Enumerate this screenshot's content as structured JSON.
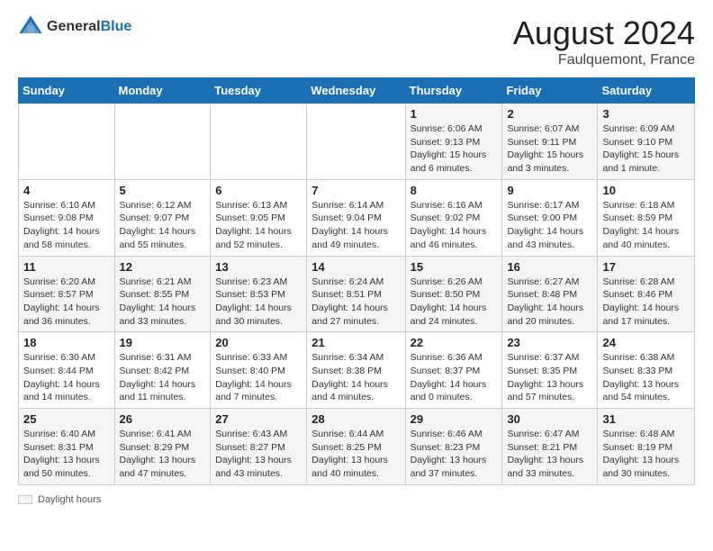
{
  "header": {
    "logo_general": "General",
    "logo_blue": "Blue",
    "month_year": "August 2024",
    "location": "Faulquemont, France"
  },
  "days_of_week": [
    "Sunday",
    "Monday",
    "Tuesday",
    "Wednesday",
    "Thursday",
    "Friday",
    "Saturday"
  ],
  "weeks": [
    [
      {
        "day": "",
        "info": ""
      },
      {
        "day": "",
        "info": ""
      },
      {
        "day": "",
        "info": ""
      },
      {
        "day": "",
        "info": ""
      },
      {
        "day": "1",
        "info": "Sunrise: 6:06 AM\nSunset: 9:13 PM\nDaylight: 15 hours and 6 minutes."
      },
      {
        "day": "2",
        "info": "Sunrise: 6:07 AM\nSunset: 9:11 PM\nDaylight: 15 hours and 3 minutes."
      },
      {
        "day": "3",
        "info": "Sunrise: 6:09 AM\nSunset: 9:10 PM\nDaylight: 15 hours and 1 minute."
      }
    ],
    [
      {
        "day": "4",
        "info": "Sunrise: 6:10 AM\nSunset: 9:08 PM\nDaylight: 14 hours and 58 minutes."
      },
      {
        "day": "5",
        "info": "Sunrise: 6:12 AM\nSunset: 9:07 PM\nDaylight: 14 hours and 55 minutes."
      },
      {
        "day": "6",
        "info": "Sunrise: 6:13 AM\nSunset: 9:05 PM\nDaylight: 14 hours and 52 minutes."
      },
      {
        "day": "7",
        "info": "Sunrise: 6:14 AM\nSunset: 9:04 PM\nDaylight: 14 hours and 49 minutes."
      },
      {
        "day": "8",
        "info": "Sunrise: 6:16 AM\nSunset: 9:02 PM\nDaylight: 14 hours and 46 minutes."
      },
      {
        "day": "9",
        "info": "Sunrise: 6:17 AM\nSunset: 9:00 PM\nDaylight: 14 hours and 43 minutes."
      },
      {
        "day": "10",
        "info": "Sunrise: 6:18 AM\nSunset: 8:59 PM\nDaylight: 14 hours and 40 minutes."
      }
    ],
    [
      {
        "day": "11",
        "info": "Sunrise: 6:20 AM\nSunset: 8:57 PM\nDaylight: 14 hours and 36 minutes."
      },
      {
        "day": "12",
        "info": "Sunrise: 6:21 AM\nSunset: 8:55 PM\nDaylight: 14 hours and 33 minutes."
      },
      {
        "day": "13",
        "info": "Sunrise: 6:23 AM\nSunset: 8:53 PM\nDaylight: 14 hours and 30 minutes."
      },
      {
        "day": "14",
        "info": "Sunrise: 6:24 AM\nSunset: 8:51 PM\nDaylight: 14 hours and 27 minutes."
      },
      {
        "day": "15",
        "info": "Sunrise: 6:26 AM\nSunset: 8:50 PM\nDaylight: 14 hours and 24 minutes."
      },
      {
        "day": "16",
        "info": "Sunrise: 6:27 AM\nSunset: 8:48 PM\nDaylight: 14 hours and 20 minutes."
      },
      {
        "day": "17",
        "info": "Sunrise: 6:28 AM\nSunset: 8:46 PM\nDaylight: 14 hours and 17 minutes."
      }
    ],
    [
      {
        "day": "18",
        "info": "Sunrise: 6:30 AM\nSunset: 8:44 PM\nDaylight: 14 hours and 14 minutes."
      },
      {
        "day": "19",
        "info": "Sunrise: 6:31 AM\nSunset: 8:42 PM\nDaylight: 14 hours and 11 minutes."
      },
      {
        "day": "20",
        "info": "Sunrise: 6:33 AM\nSunset: 8:40 PM\nDaylight: 14 hours and 7 minutes."
      },
      {
        "day": "21",
        "info": "Sunrise: 6:34 AM\nSunset: 8:38 PM\nDaylight: 14 hours and 4 minutes."
      },
      {
        "day": "22",
        "info": "Sunrise: 6:36 AM\nSunset: 8:37 PM\nDaylight: 14 hours and 0 minutes."
      },
      {
        "day": "23",
        "info": "Sunrise: 6:37 AM\nSunset: 8:35 PM\nDaylight: 13 hours and 57 minutes."
      },
      {
        "day": "24",
        "info": "Sunrise: 6:38 AM\nSunset: 8:33 PM\nDaylight: 13 hours and 54 minutes."
      }
    ],
    [
      {
        "day": "25",
        "info": "Sunrise: 6:40 AM\nSunset: 8:31 PM\nDaylight: 13 hours and 50 minutes."
      },
      {
        "day": "26",
        "info": "Sunrise: 6:41 AM\nSunset: 8:29 PM\nDaylight: 13 hours and 47 minutes."
      },
      {
        "day": "27",
        "info": "Sunrise: 6:43 AM\nSunset: 8:27 PM\nDaylight: 13 hours and 43 minutes."
      },
      {
        "day": "28",
        "info": "Sunrise: 6:44 AM\nSunset: 8:25 PM\nDaylight: 13 hours and 40 minutes."
      },
      {
        "day": "29",
        "info": "Sunrise: 6:46 AM\nSunset: 8:23 PM\nDaylight: 13 hours and 37 minutes."
      },
      {
        "day": "30",
        "info": "Sunrise: 6:47 AM\nSunset: 8:21 PM\nDaylight: 13 hours and 33 minutes."
      },
      {
        "day": "31",
        "info": "Sunrise: 6:48 AM\nSunset: 8:19 PM\nDaylight: 13 hours and 30 minutes."
      }
    ]
  ],
  "footer": {
    "daylight_label": "Daylight hours"
  }
}
